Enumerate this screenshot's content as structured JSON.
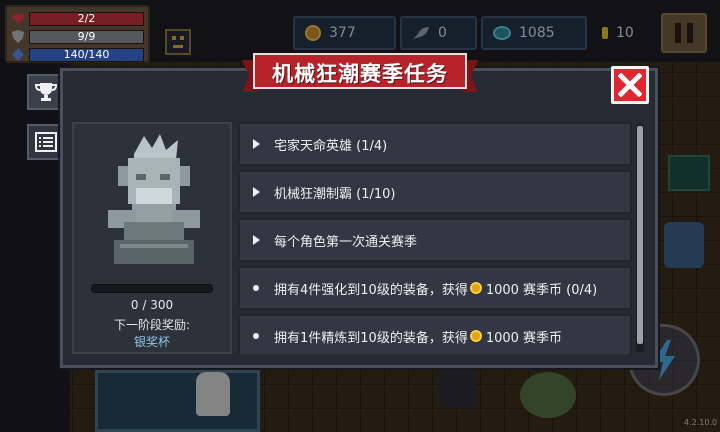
{
  "hud": {
    "health": {
      "text": "2/2",
      "fraction": 1.0,
      "color": "#c0303a"
    },
    "armor": {
      "text": "9/9",
      "fraction": 1.0,
      "color": "#8a8f98"
    },
    "energy": {
      "text": "140/140",
      "fraction": 1.0,
      "color": "#3a6ad0"
    },
    "coins": "377",
    "materials": "0",
    "gems": "1085",
    "energy_count": "10"
  },
  "modal": {
    "title": "机械狂潮赛季任务",
    "close_icon": "close-x-icon",
    "side_tabs": [
      {
        "icon": "trophy-icon"
      },
      {
        "icon": "list-icon"
      }
    ],
    "reward": {
      "progress_text": "0 / 300",
      "progress_fraction": 0.0,
      "next_label": "下一阶段奖励:",
      "next_reward": "银奖杯"
    },
    "tasks": [
      {
        "marker": "triangle",
        "text": "宅家天命英雄 (1/4)"
      },
      {
        "marker": "triangle",
        "text": "机械狂潮制霸 (1/10)"
      },
      {
        "marker": "triangle",
        "text": "每个角色第一次通关赛季"
      },
      {
        "marker": "dot",
        "text_before": "拥有4件强化到10级的装备，获得",
        "text_after": "1000 赛季币 (0/4)"
      },
      {
        "marker": "dot",
        "text_before": "拥有1件精炼到10级的装备，获得",
        "text_after": "1000 赛季币"
      }
    ]
  },
  "version": "4.2.10.0",
  "colors": {
    "ribbon": "#b8222a",
    "close": "#e0262e",
    "accent_gold": "#d5b24a"
  }
}
